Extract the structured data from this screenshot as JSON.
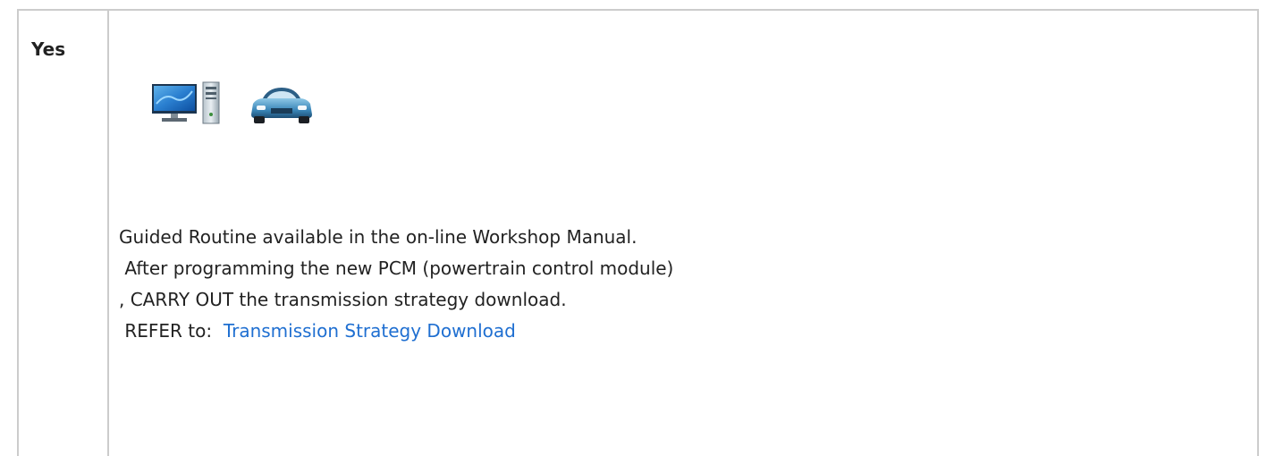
{
  "table": {
    "label_cell": "Yes"
  },
  "icons": {
    "computer": "computer-icon",
    "vehicle": "vehicle-icon"
  },
  "content": {
    "line1": "Guided Routine available in the on-line Workshop Manual.",
    "line2": " After programming the new PCM (powertrain control module)",
    "line3": ", CARRY OUT the transmission strategy download.",
    "refer_prefix": " REFER to:  ",
    "refer_link": "Transmission Strategy Download"
  },
  "colors": {
    "link": "#1f6fd1",
    "border": "#cccccc",
    "text": "#222222"
  }
}
